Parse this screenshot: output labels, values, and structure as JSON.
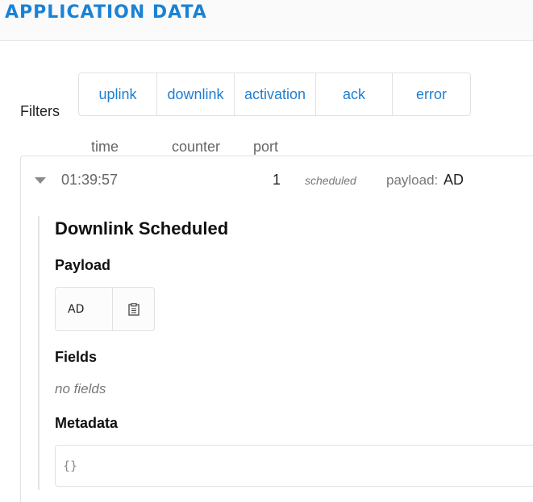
{
  "header": {
    "title": "APPLICATION DATA"
  },
  "filters": {
    "label": "Filters",
    "options": [
      "uplink",
      "downlink",
      "activation",
      "ack",
      "error"
    ]
  },
  "columns": {
    "time": "time",
    "counter": "counter",
    "port": "port"
  },
  "entry": {
    "time": "01:39:57",
    "port": "1",
    "status": "scheduled",
    "payload_label": "payload:",
    "payload_value": "AD"
  },
  "detail": {
    "title": "Downlink Scheduled",
    "payload_heading": "Payload",
    "payload_value": "AD",
    "fields_heading": "Fields",
    "no_fields_text": "no fields",
    "metadata_heading": "Metadata",
    "metadata_value": "{}"
  },
  "icons": {
    "expand": "caret-down-icon",
    "copy": "clipboard-icon"
  },
  "colors": {
    "accent": "#1a82d6",
    "link": "#1f7ed0"
  }
}
